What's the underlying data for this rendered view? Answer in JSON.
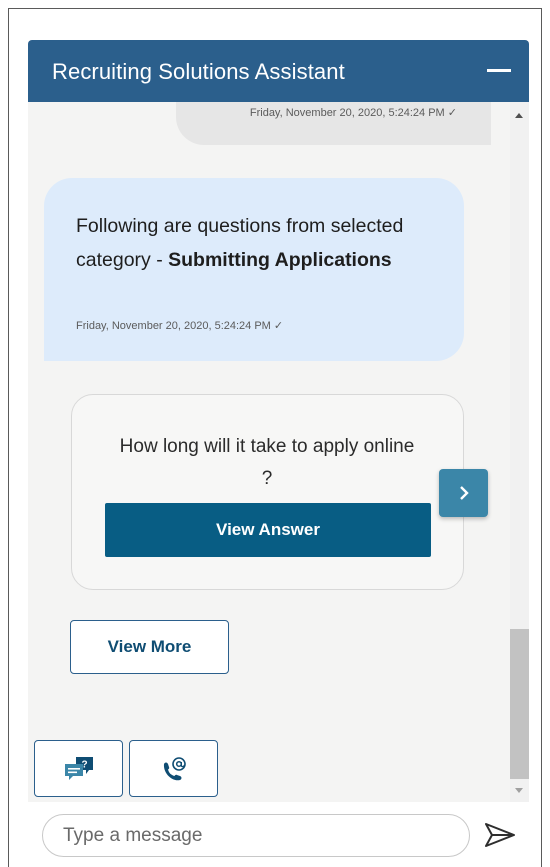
{
  "header": {
    "title": "Recruiting Solutions Assistant",
    "minimize_icon": "minimize-icon"
  },
  "messages": {
    "user_timestamp": "Friday, November 20, 2020, 5:24:24 PM ✓",
    "bot_text_prefix": "Following are questions from selected category - ",
    "bot_category": "Submitting Applications",
    "bot_timestamp": "Friday, November 20, 2020, 5:24:24 PM ✓"
  },
  "card": {
    "question": "How long will it take to apply online ?",
    "button_label": "View Answer",
    "next_icon": "chevron-right-icon"
  },
  "view_more_label": "View More",
  "quick_actions": [
    {
      "name": "faq",
      "icon": "question-chat-icon"
    },
    {
      "name": "contact",
      "icon": "phone-email-icon"
    }
  ],
  "composer": {
    "placeholder": "Type a message",
    "send_icon": "send-icon"
  },
  "colors": {
    "header": "#2b5f8c",
    "primary_button": "#085d84",
    "bot_bubble": "#ddebfb",
    "next_button": "#3b86a8"
  }
}
